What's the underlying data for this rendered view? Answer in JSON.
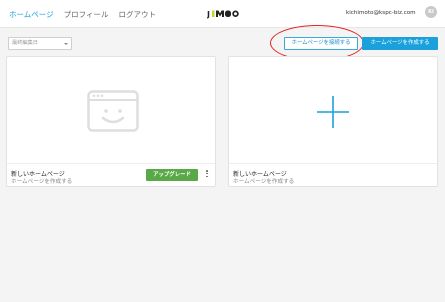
{
  "header": {
    "nav": [
      {
        "label": "ホームページ",
        "active": true
      },
      {
        "label": "プロフィール",
        "active": false
      },
      {
        "label": "ログアウト",
        "active": false
      }
    ],
    "logo_text": "JIMDO",
    "user_email": "kichimoto@kspc-biz.com",
    "avatar_initials": "KI"
  },
  "toolbar": {
    "sort_value": "最終編集日",
    "connect_label": "ホームページを接続する",
    "create_label": "ホームページを作成する"
  },
  "cards": [
    {
      "title": "新しいホームページ",
      "subtitle": "ホームページを作成する",
      "upgrade_label": "アップグレード",
      "icon": "browser-smiley-icon"
    },
    {
      "title": "新しいホームページ",
      "subtitle": "ホームページを作成する",
      "icon": "plus-icon"
    }
  ],
  "colors": {
    "accent": "#1aa1dc",
    "upgrade_green": "#5aa948",
    "highlight_red": "#e0201c"
  }
}
